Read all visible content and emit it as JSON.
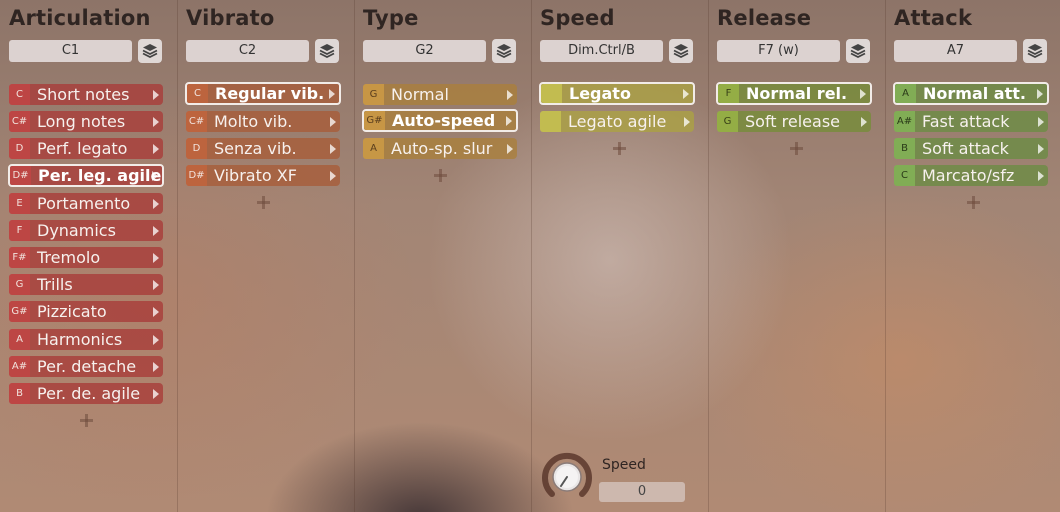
{
  "columns": [
    {
      "title": "Articulation",
      "selector": "C1",
      "theme": "red",
      "items": [
        {
          "key": "C",
          "label": "Short notes"
        },
        {
          "key": "C#",
          "label": "Long notes"
        },
        {
          "key": "D",
          "label": "Perf. legato"
        },
        {
          "key": "D#",
          "label": "Per. leg. agile"
        },
        {
          "key": "E",
          "label": "Portamento"
        },
        {
          "key": "F",
          "label": "Dynamics"
        },
        {
          "key": "F#",
          "label": "Tremolo"
        },
        {
          "key": "G",
          "label": "Trills"
        },
        {
          "key": "G#",
          "label": "Pizzicato"
        },
        {
          "key": "A",
          "label": "Harmonics"
        },
        {
          "key": "A#",
          "label": "Per. detache"
        },
        {
          "key": "B",
          "label": "Per. de. agile"
        }
      ]
    },
    {
      "title": "Vibrato",
      "selector": "C2",
      "theme": "orange",
      "items": [
        {
          "key": "C",
          "label": "Regular vib."
        },
        {
          "key": "C#",
          "label": "Molto vib."
        },
        {
          "key": "D",
          "label": "Senza vib."
        },
        {
          "key": "D#",
          "label": "Vibrato XF"
        }
      ]
    },
    {
      "title": "Type",
      "selector": "G2",
      "theme": "gold",
      "items": [
        {
          "key": "G",
          "label": "Normal"
        },
        {
          "key": "G#",
          "label": "Auto-speed"
        },
        {
          "key": "A",
          "label": "Auto-sp. slur"
        }
      ]
    },
    {
      "title": "Speed",
      "selector": "Dim.Ctrl/B",
      "theme": "olive",
      "items": [
        {
          "key": "",
          "label": "Legato"
        },
        {
          "key": "",
          "label": "Legato agile"
        }
      ]
    },
    {
      "title": "Release",
      "selector": "F7 (w)",
      "theme": "olivegreen",
      "items": [
        {
          "key": "F",
          "label": "Normal rel."
        },
        {
          "key": "G",
          "label": "Soft release"
        }
      ]
    },
    {
      "title": "Attack",
      "selector": "A7",
      "theme": "green",
      "items": [
        {
          "key": "A",
          "label": "Normal att."
        },
        {
          "key": "A#",
          "label": "Fast attack"
        },
        {
          "key": "B",
          "label": "Soft attack"
        },
        {
          "key": "C",
          "label": "Marcato/sfz"
        }
      ]
    }
  ],
  "speed_control": {
    "label": "Speed",
    "value": "0"
  }
}
